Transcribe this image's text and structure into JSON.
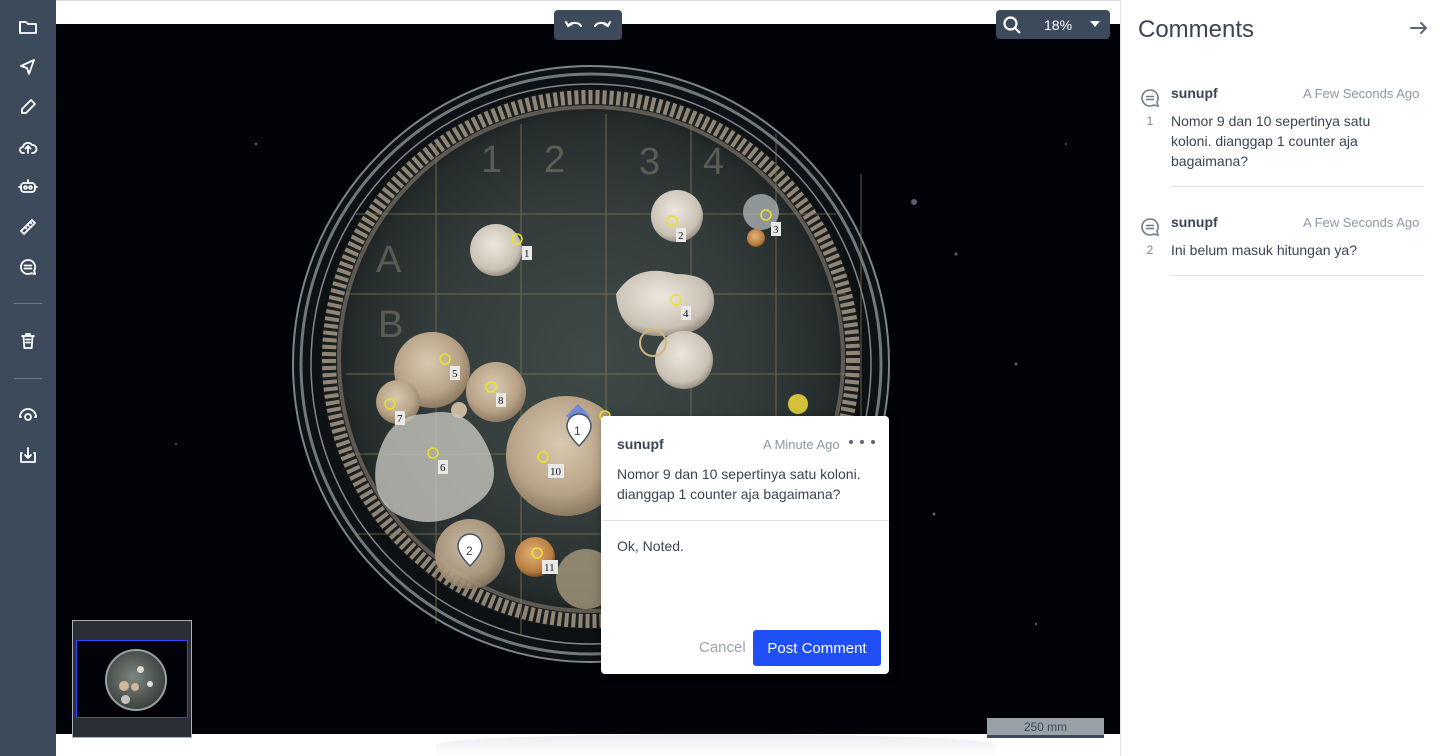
{
  "toolbar": {
    "tools": [
      "folder-icon",
      "select-arrow-icon",
      "pencil-icon",
      "cloud-upload-icon",
      "robot-icon",
      "ruler-icon",
      "comment-icon",
      "trash-icon",
      "eye-icon",
      "download-icon"
    ]
  },
  "canvas": {
    "zoom_value": "18%",
    "scale_label": "250 mm",
    "colony_labels": [
      "1",
      "2",
      "3",
      "4",
      "5",
      "6",
      "7",
      "8",
      "10",
      "11"
    ],
    "markers": [
      "1",
      "2"
    ]
  },
  "popup": {
    "author": "sunupf",
    "time": "A Minute Ago",
    "body": "Nomor 9 dan 10 sepertinya satu koloni. dianggap 1 counter aja bagaimana?",
    "reply_value": "Ok, Noted.",
    "cancel_label": "Cancel",
    "post_label": "Post Comment"
  },
  "panel": {
    "title": "Comments",
    "comments": [
      {
        "number": "1",
        "author": "sunupf",
        "time": "A Few Seconds Ago",
        "text": "Nomor 9 dan 10 sepertinya satu koloni. dianggap 1 counter aja bagaimana?"
      },
      {
        "number": "2",
        "author": "sunupf",
        "time": "A Few Seconds Ago",
        "text": "Ini belum masuk hitungan ya?"
      }
    ]
  },
  "colors": {
    "toolbar_bg": "#3c4a5c",
    "accent_blue": "#1f4ff5",
    "marker_yellow": "#e8e22a"
  }
}
